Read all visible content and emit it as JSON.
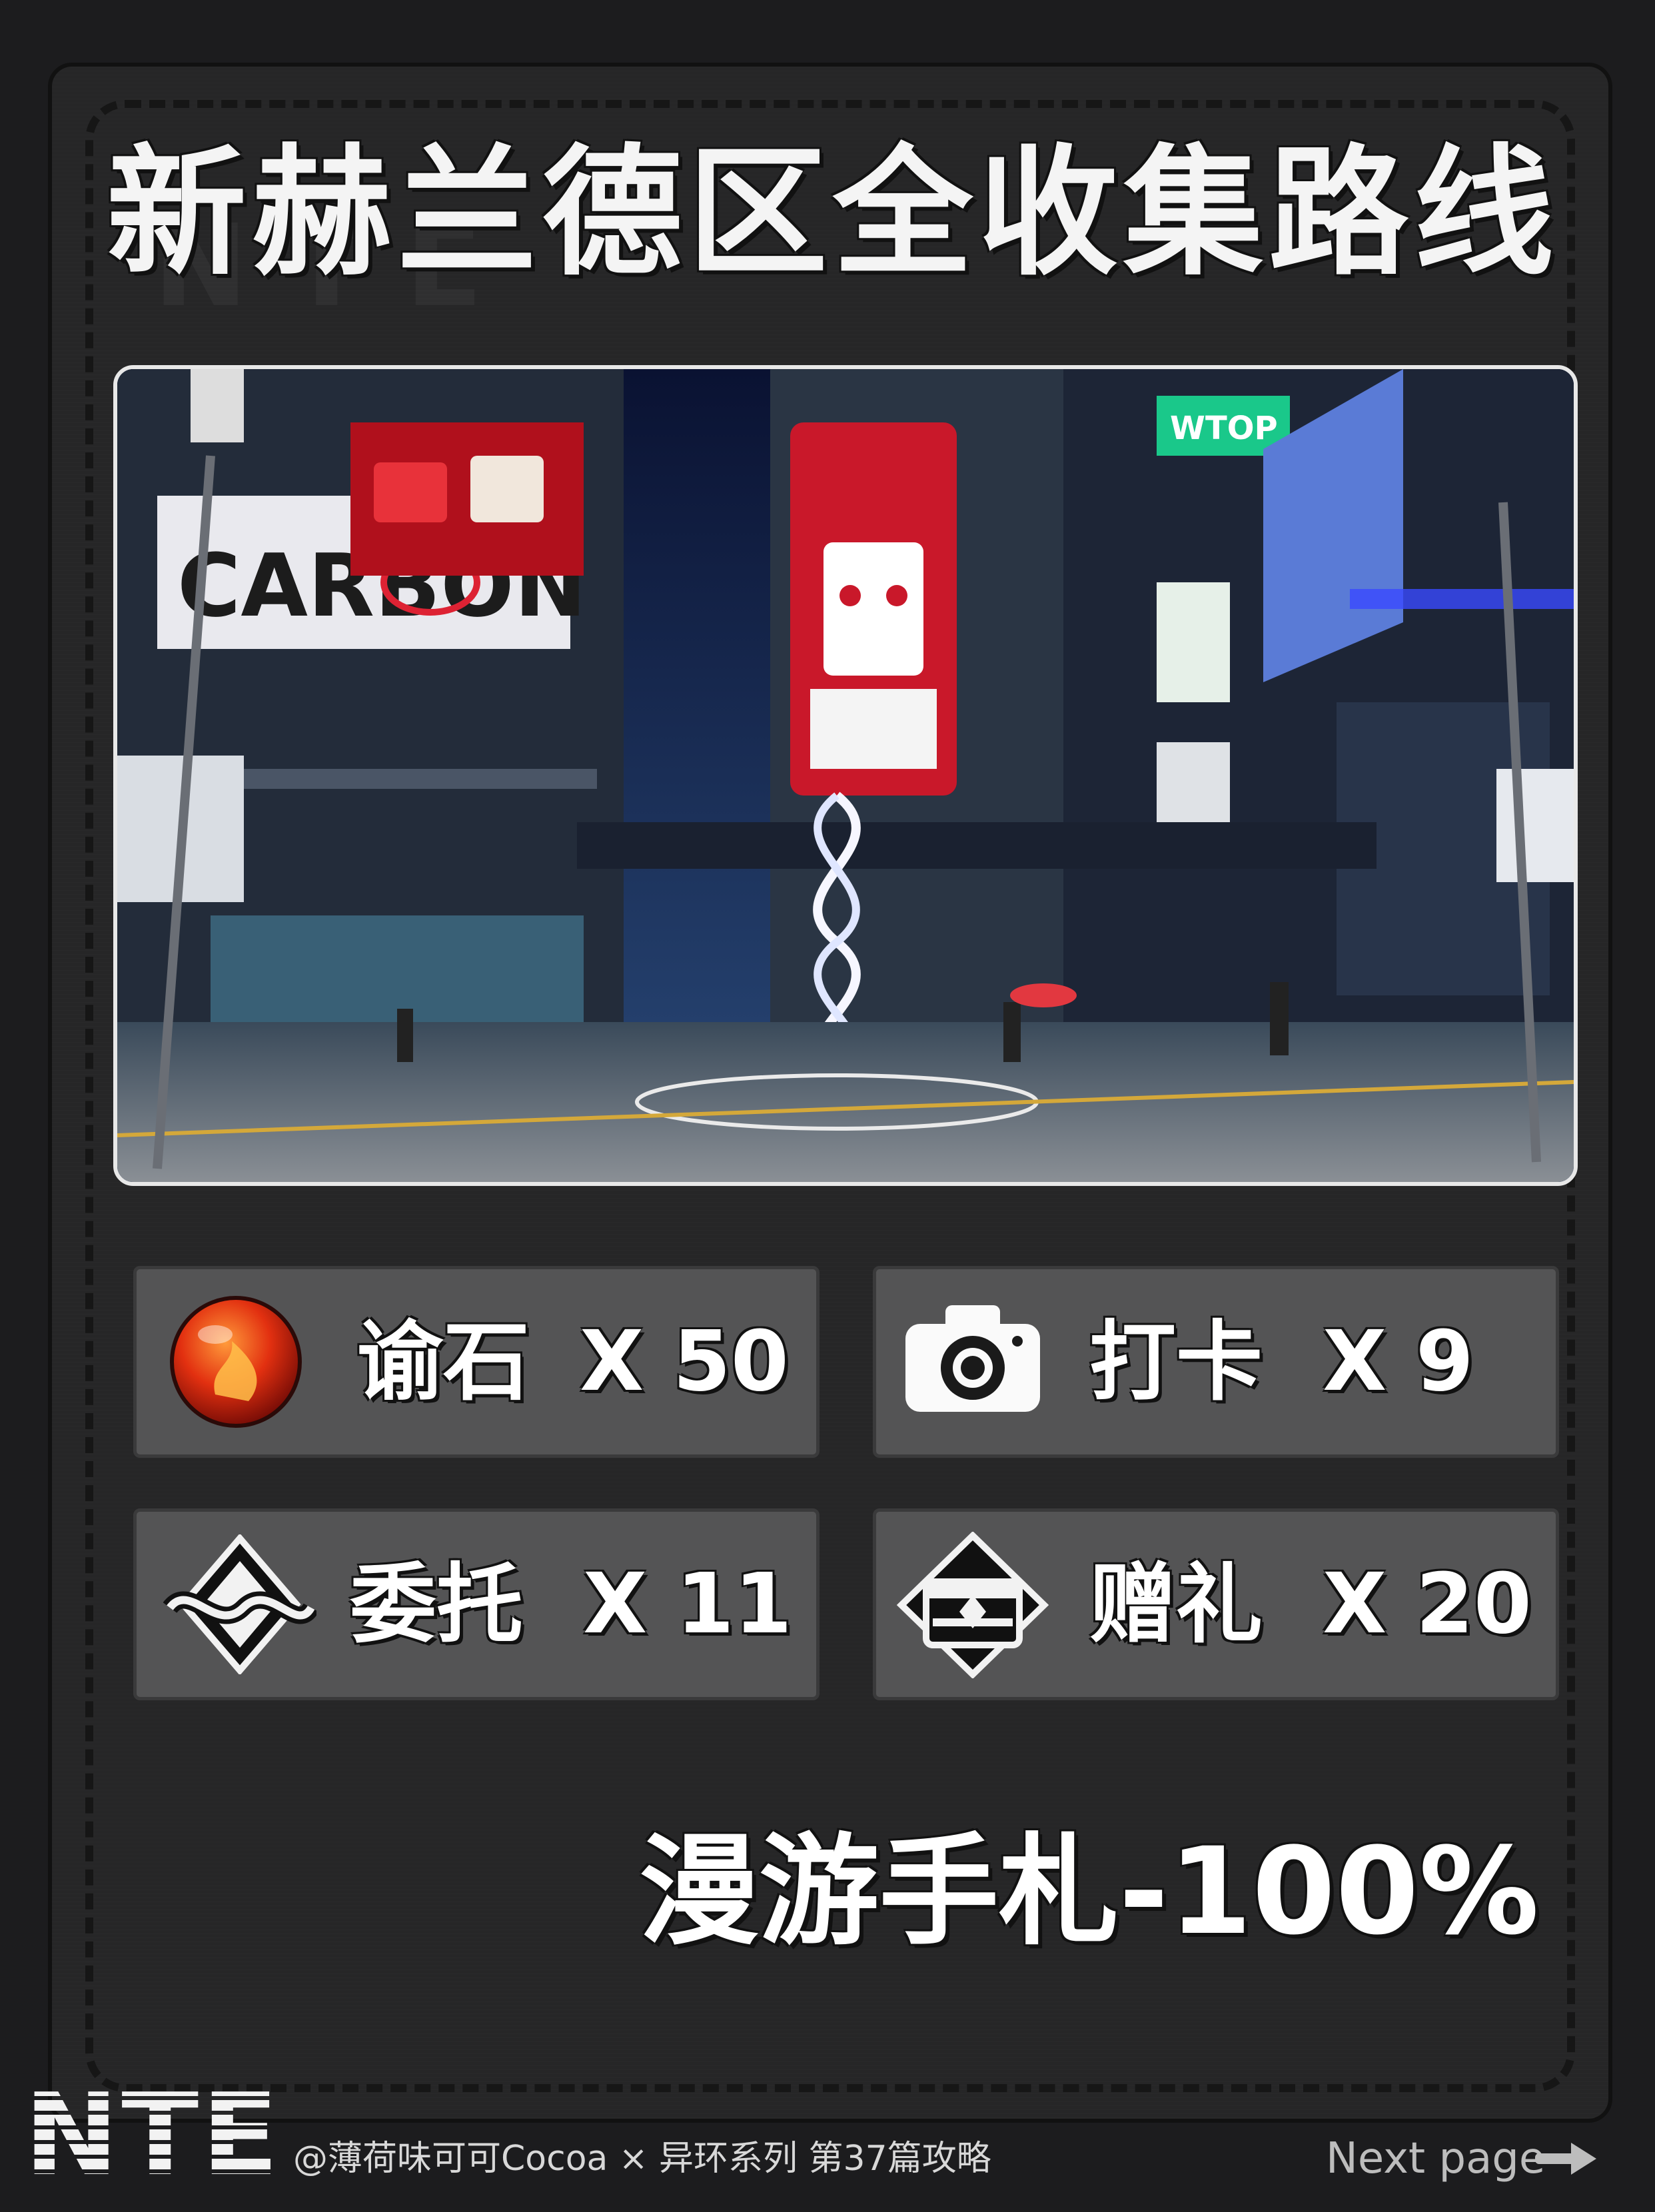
{
  "title": "新赫兰德区全收集路线",
  "items": [
    {
      "label": "谕石",
      "count": "X 50",
      "icon": "orb-icon"
    },
    {
      "label": "打卡",
      "count": "X 9",
      "icon": "camera-icon"
    },
    {
      "label": "委托",
      "count": "X 11",
      "icon": "commission-icon"
    },
    {
      "label": "赠礼",
      "count": "X 20",
      "icon": "gift-icon"
    }
  ],
  "progress": "漫游手札-100%",
  "logo": "NTE",
  "credit": "@薄荷味可可Cocoa × 异环系列 第37篇攻略",
  "next": "Next page",
  "colors": {
    "background": "#1c1c1e",
    "card": "#262627",
    "tile": "#545455",
    "text": "#ffffff"
  }
}
